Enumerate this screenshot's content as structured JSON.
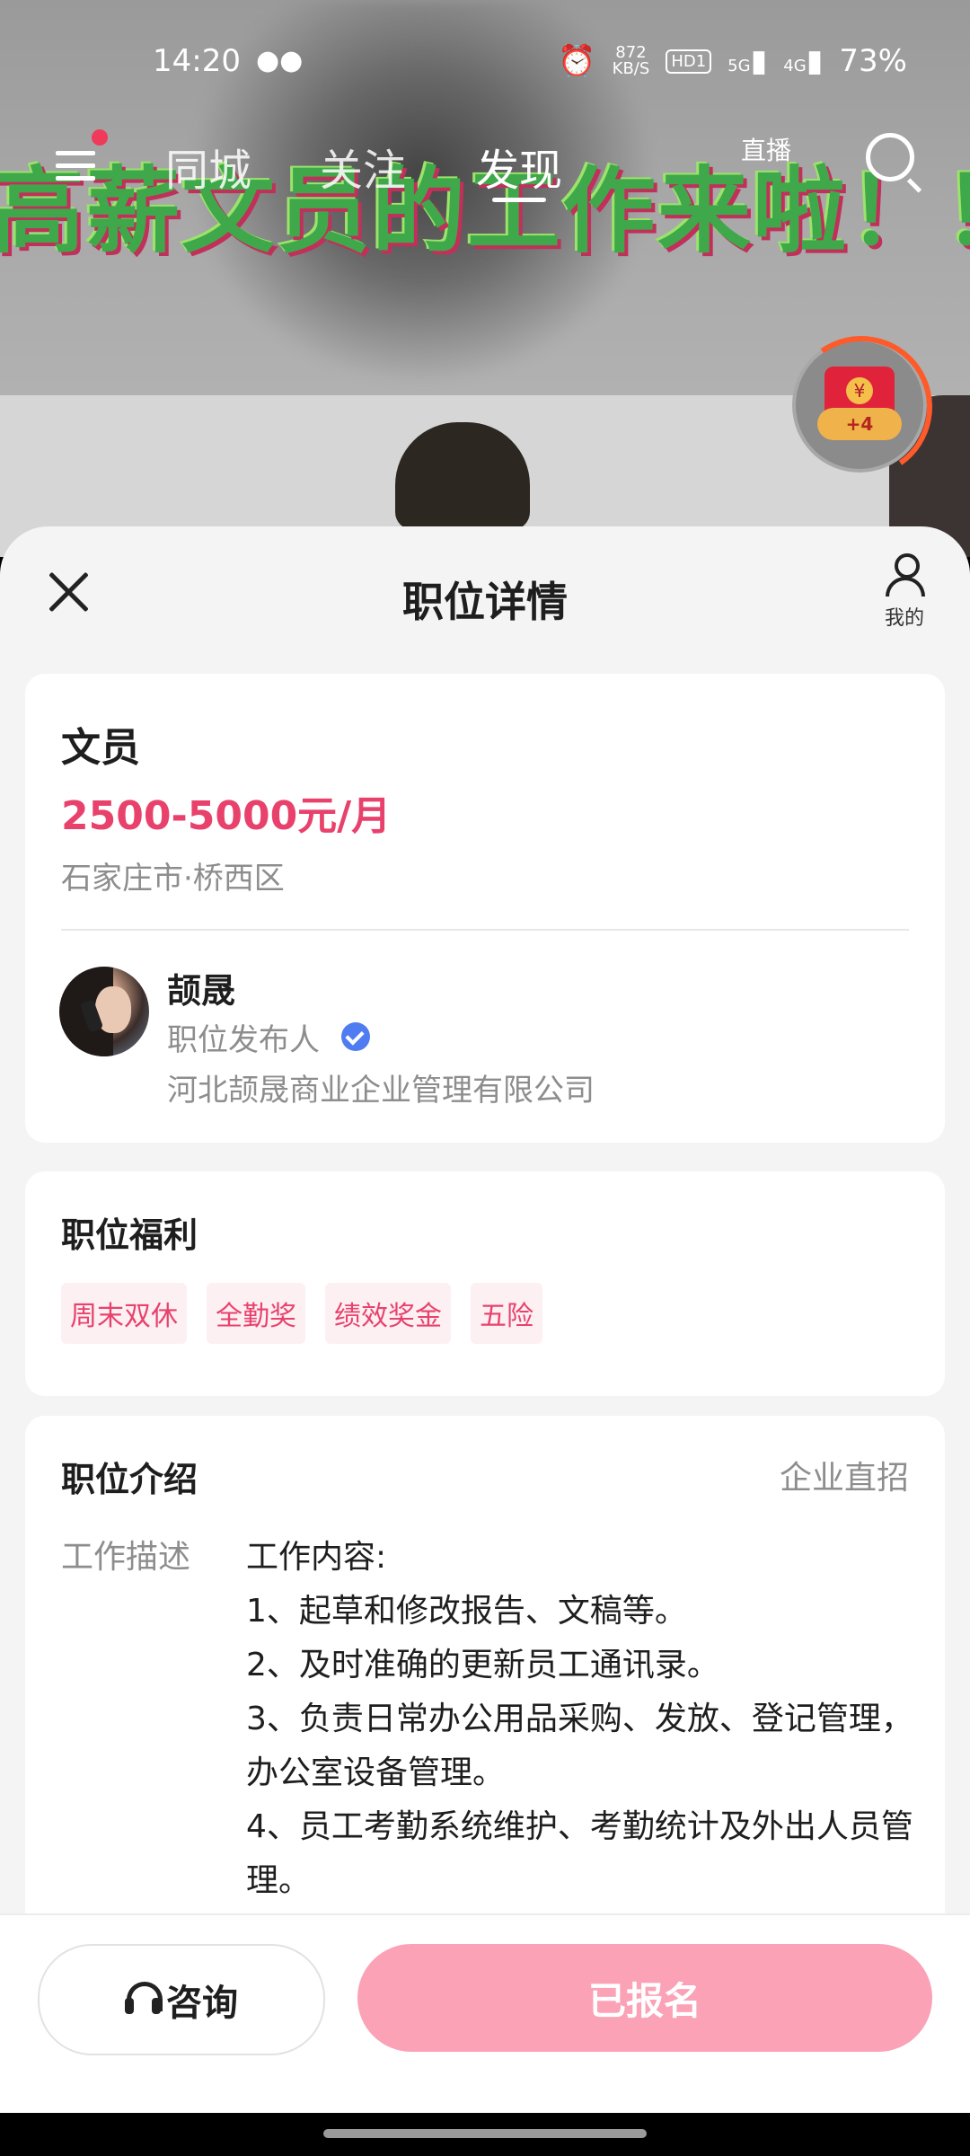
{
  "status_bar": {
    "time": "14:20",
    "wechat_icon": "wechat-icon",
    "net_speed": "872",
    "net_unit": "KB/S",
    "hd_badge": "HD1",
    "signal_1": "5G",
    "signal_2": "4G",
    "battery": "73%"
  },
  "video": {
    "overlay_text": "高薪文员的工作来啦！！"
  },
  "top_nav": {
    "tabs": [
      {
        "label": "同城"
      },
      {
        "label": "关注"
      },
      {
        "label": "发现"
      }
    ],
    "active_tab": "发现",
    "live_label": "直播"
  },
  "red_packet": {
    "coin_symbol": "¥",
    "badge": "+4"
  },
  "sheet": {
    "title": "职位详情",
    "mine_label": "我的"
  },
  "job": {
    "title": "文员",
    "salary": "2500-5000元/月",
    "location": "石家庄市·桥西区"
  },
  "recruiter": {
    "name": "颉晟",
    "role": "职位发布人",
    "company": "河北颉晟商业企业管理有限公司"
  },
  "benefits": {
    "title": "职位福利",
    "tags": [
      "周末双休",
      "全勤奖",
      "绩效奖金",
      "五险"
    ]
  },
  "intro": {
    "title": "职位介绍",
    "hire_type": "企业直招",
    "desc_label": "工作描述",
    "lines": [
      "工作内容:",
      "1、起草和修改报告、文稿等。",
      "2、及时准确的更新员工通讯录。",
      "3、负责日常办公用品采购、发放、登记管理，办公室设备管理。",
      "4、员工考勤系统维护、考勤统计及外出人员管理。"
    ]
  },
  "actions": {
    "consult_label": "咨询",
    "applied_label": "已报名"
  },
  "colors": {
    "accent": "#e8426c",
    "applied_button": "#fba2b7",
    "verified": "#4f7cf0"
  }
}
